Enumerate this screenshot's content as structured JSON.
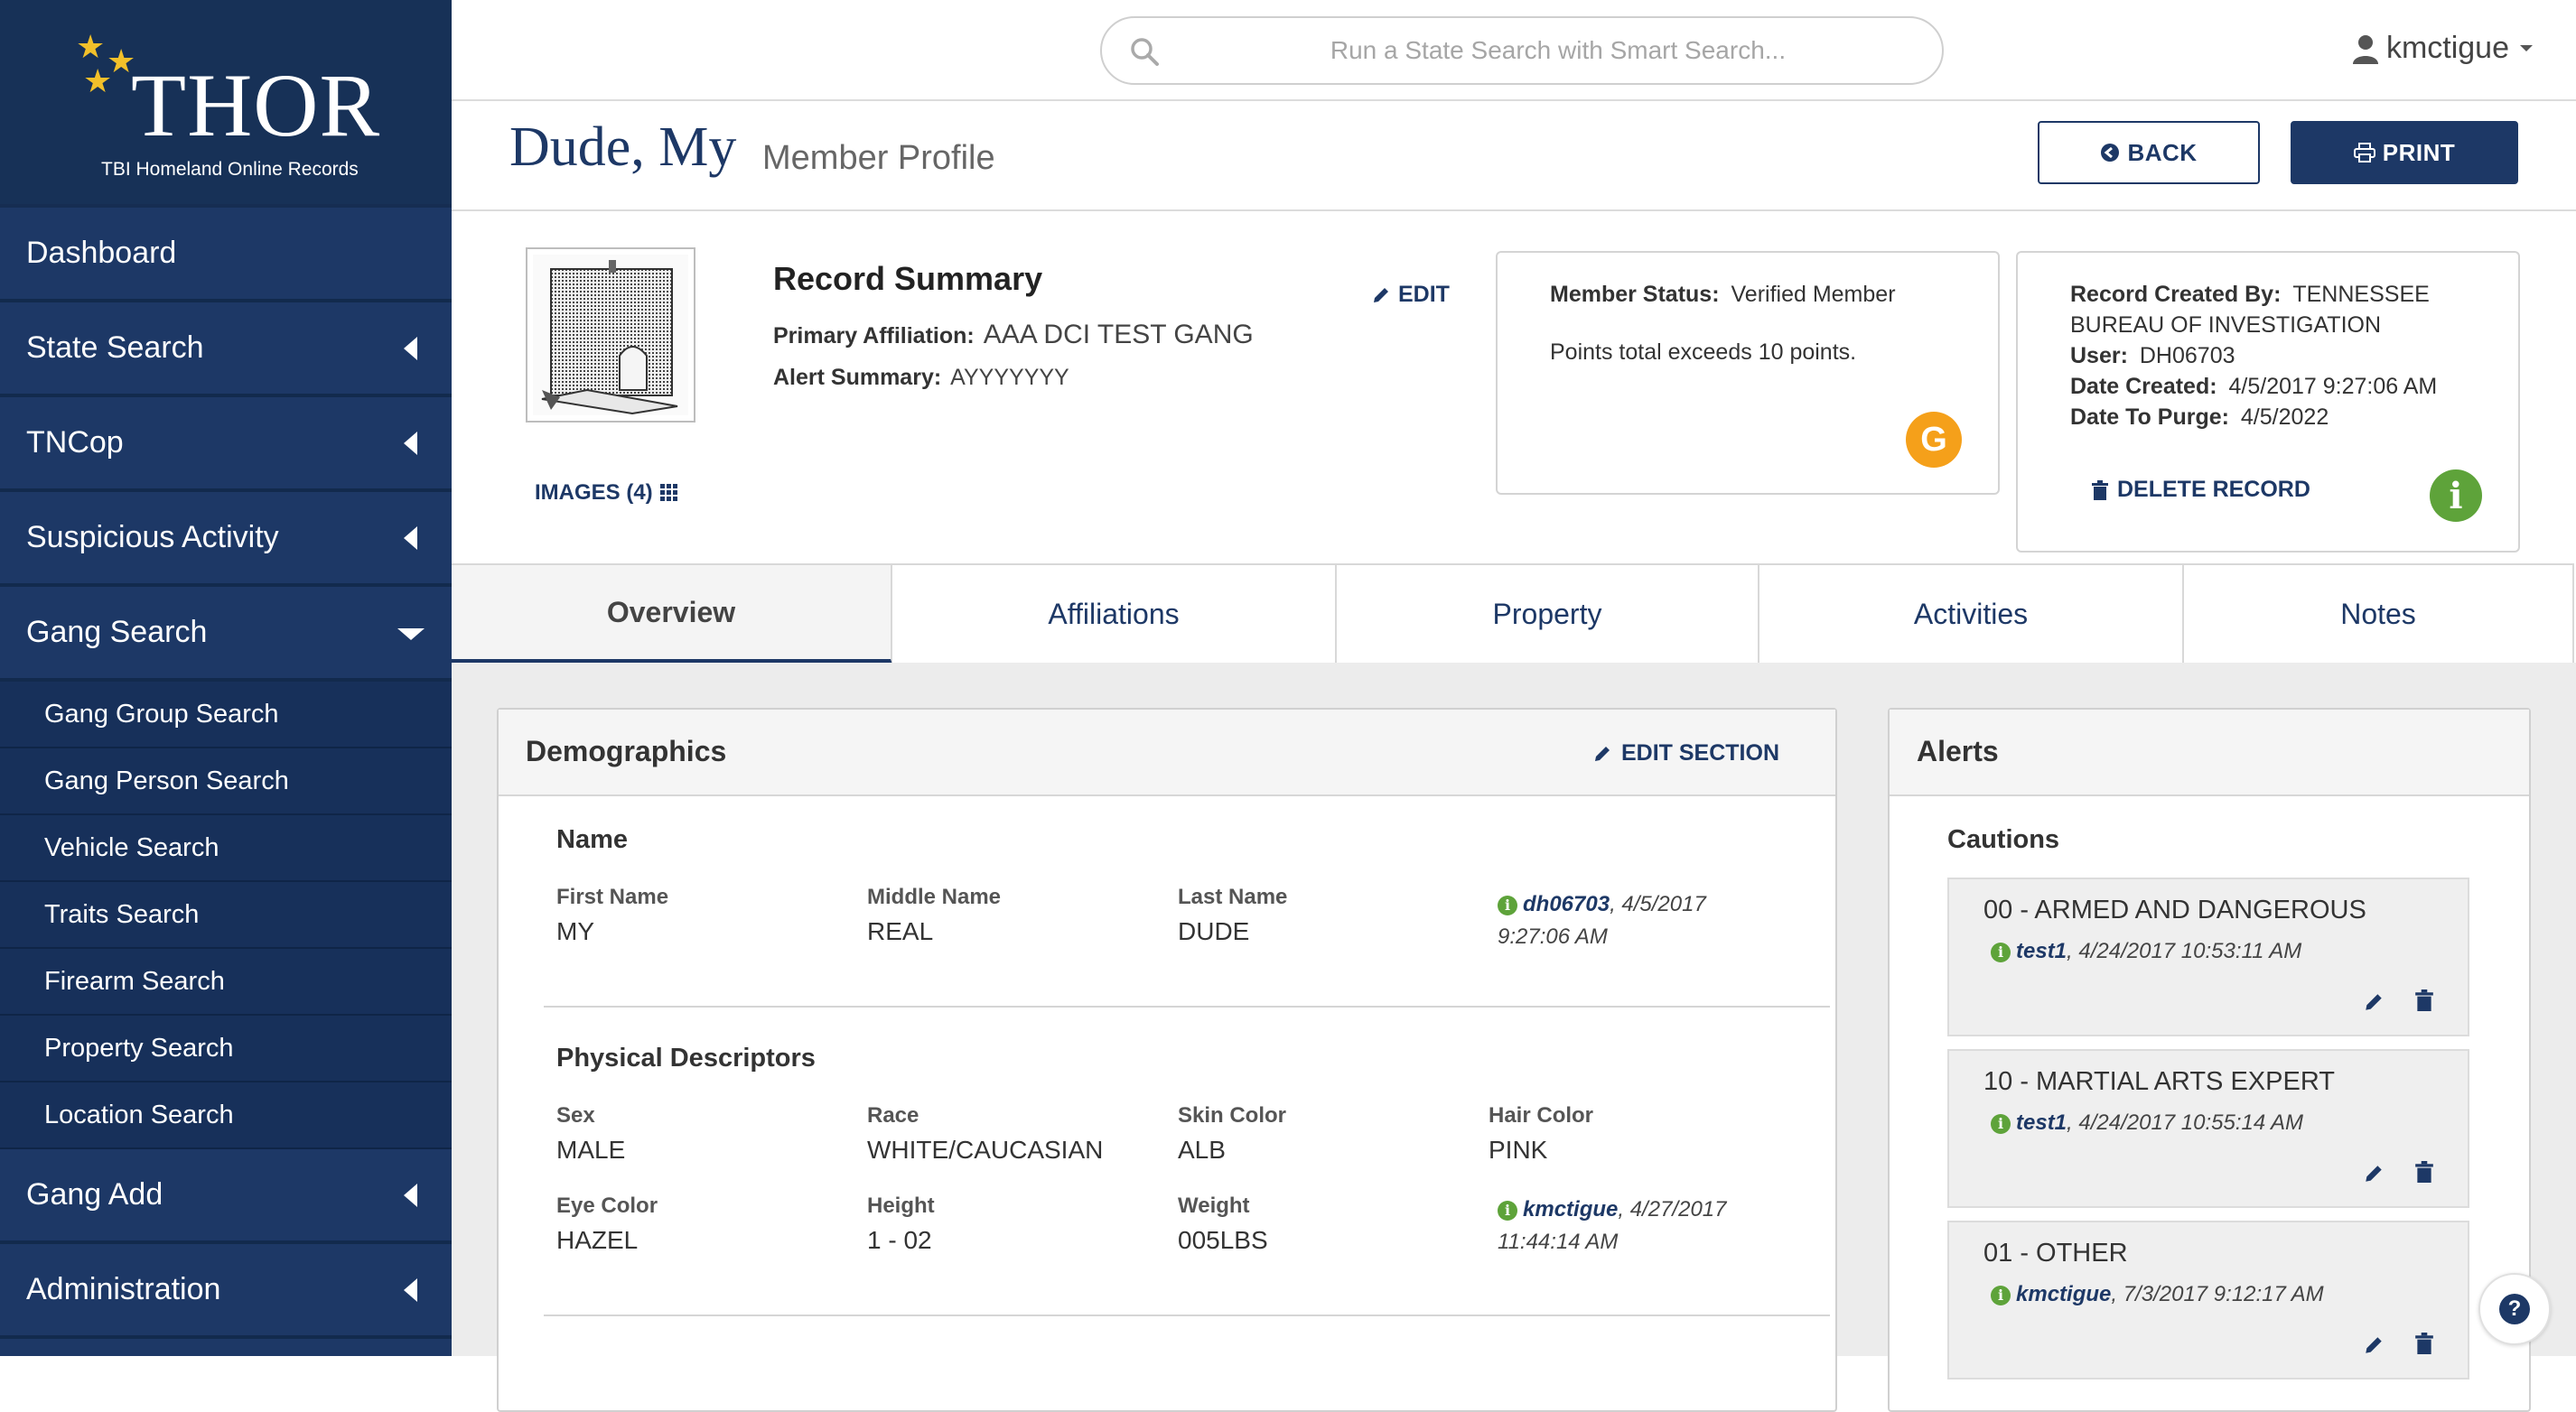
{
  "app": {
    "logo_title": "THOR",
    "logo_subtitle": "TBI Homeland Online Records"
  },
  "sidebar": {
    "items": [
      {
        "label": "Dashboard"
      },
      {
        "label": "State Search"
      },
      {
        "label": "TNCop"
      },
      {
        "label": "Suspicious Activity"
      },
      {
        "label": "Gang Search"
      },
      {
        "label": "Gang Add"
      },
      {
        "label": "Administration"
      }
    ],
    "gang_search_sub": [
      {
        "label": "Gang Group Search"
      },
      {
        "label": "Gang Person Search"
      },
      {
        "label": "Vehicle Search"
      },
      {
        "label": "Traits Search"
      },
      {
        "label": "Firearm Search"
      },
      {
        "label": "Property Search"
      },
      {
        "label": "Location Search"
      }
    ]
  },
  "topbar": {
    "search_placeholder": "Run a State Search with Smart Search...",
    "username": "kmctigue"
  },
  "page": {
    "title": "Dude, My",
    "subtitle": "Member Profile",
    "back_label": "BACK",
    "print_label": "PRINT"
  },
  "summary": {
    "images_label": "IMAGES (4)",
    "title": "Record Summary",
    "edit_label": "EDIT",
    "primary_affiliation_label": "Primary Affiliation:",
    "primary_affiliation": "AAA DCI TEST GANG",
    "alert_summary_label": "Alert Summary:",
    "alert_summary": "AYYYYYYY",
    "member_status_label": "Member Status:",
    "member_status": "Verified Member",
    "points_note": "Points total exceeds 10 points.",
    "badge": "G",
    "created_by_label": "Record Created By:",
    "created_by_line1": "TENNESSEE",
    "created_by_line2": "BUREAU OF INVESTIGATION",
    "user_label": "User:",
    "user": "DH06703",
    "date_created_label": "Date Created:",
    "date_created": "4/5/2017 9:27:06 AM",
    "date_purge_label": "Date To Purge:",
    "date_purge": "4/5/2022",
    "delete_label": "DELETE RECORD",
    "info_badge": "i"
  },
  "tabs": [
    {
      "label": "Overview"
    },
    {
      "label": "Affiliations"
    },
    {
      "label": "Property"
    },
    {
      "label": "Activities"
    },
    {
      "label": "Notes"
    }
  ],
  "demographics": {
    "title": "Demographics",
    "edit_section_label": "EDIT SECTION",
    "name_section": "Name",
    "first_name_label": "First Name",
    "first_name": "MY",
    "middle_name_label": "Middle Name",
    "middle_name": "REAL",
    "last_name_label": "Last Name",
    "last_name": "DUDE",
    "name_audit_user": "dh06703",
    "name_audit_date1": ", 4/5/2017",
    "name_audit_date2": "9:27:06 AM",
    "physical_section": "Physical Descriptors",
    "sex_label": "Sex",
    "sex": "MALE",
    "race_label": "Race",
    "race": "WHITE/CAUCASIAN",
    "skin_label": "Skin Color",
    "skin": "ALB",
    "hair_label": "Hair Color",
    "hair": "PINK",
    "eye_label": "Eye Color",
    "eye": "HAZEL",
    "height_label": "Height",
    "height": "1 - 02",
    "weight_label": "Weight",
    "weight": "005LBS",
    "phys_audit_user": "kmctigue",
    "phys_audit_date1": ", 4/27/2017",
    "phys_audit_date2": "11:44:14 AM"
  },
  "alerts": {
    "title": "Alerts",
    "cautions_label": "Cautions",
    "items": [
      {
        "title": "00 - ARMED AND DANGEROUS",
        "user": "test1",
        "date": ", 4/24/2017 10:53:11 AM"
      },
      {
        "title": "10 - MARTIAL ARTS EXPERT",
        "user": "test1",
        "date": ", 4/24/2017 10:55:14 AM"
      },
      {
        "title": "01 - OTHER",
        "user": "kmctigue",
        "date": ", 7/3/2017 9:12:17 AM"
      }
    ]
  },
  "help_label": "?",
  "colors": {
    "brand_navy": "#1d3866",
    "badge_orange": "#f5a01a",
    "info_green": "#5ea33a"
  }
}
